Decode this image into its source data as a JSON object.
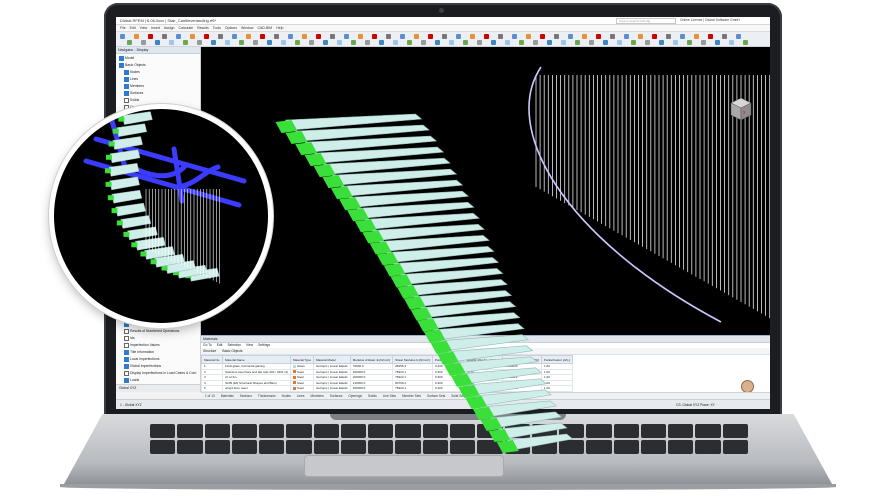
{
  "app": {
    "title": "Dlubal RFEM | 6.06.0xxx | Stair_Cantileverlanding.rf6*",
    "search_placeholder": "Type to search (Ctrl+Q)",
    "user": "Online License | Dlubal Software GmbH"
  },
  "menu": [
    "File",
    "Edit",
    "View",
    "Insert",
    "Assign",
    "Calculate",
    "Results",
    "Tools",
    "Options",
    "Window",
    "CAD-BIM",
    "Help"
  ],
  "navigator": {
    "title": "Navigator - Display",
    "items": [
      {
        "label": "Model",
        "checked": true
      },
      {
        "label": "Basic Objects",
        "checked": true
      },
      {
        "label": "Nodes",
        "checked": true
      },
      {
        "label": "Lines",
        "checked": true
      },
      {
        "label": "Members",
        "checked": true
      },
      {
        "label": "Surfaces",
        "checked": true
      },
      {
        "label": "Solids",
        "checked": false
      },
      {
        "label": "Openings",
        "checked": false
      },
      {
        "label": "Types for Nodes",
        "checked": false
      },
      {
        "label": "Types for Lines",
        "checked": false
      },
      {
        "label": "Types for Members",
        "checked": false
      },
      {
        "label": "Types for Surfaces",
        "checked": false
      },
      {
        "label": "Types for Solids",
        "checked": false
      },
      {
        "label": "Types for Special Objects",
        "checked": false
      },
      {
        "label": "Special Objects",
        "checked": false
      },
      {
        "label": "Guide Objects",
        "checked": false
      },
      {
        "label": "Types for Stability",
        "checked": false
      },
      {
        "label": "Types for Steel Design",
        "checked": false
      },
      {
        "label": "Types for Concrete Design",
        "checked": false
      },
      {
        "label": "Types for Timber Design",
        "checked": false
      },
      {
        "label": "Types for Aluminum Design",
        "checked": false
      },
      {
        "label": "Types for Modal Analysis",
        "checked": false
      },
      {
        "label": "Types for Spectral Analysis",
        "checked": false
      },
      {
        "label": "Types for Time History",
        "checked": false
      },
      {
        "label": "Types for Pushover Analysis",
        "checked": false
      },
      {
        "label": "Types for Harmonic Response",
        "checked": false
      },
      {
        "label": "Types for Building Model",
        "checked": false
      },
      {
        "label": "Types for Form-Finding",
        "checked": false
      },
      {
        "label": "Types for Cutting Patterns",
        "checked": false
      },
      {
        "label": "Types for Design Overview",
        "checked": false
      },
      {
        "label": "Types for Solids",
        "checked": false
      },
      {
        "label": "Types for Piles",
        "checked": false
      },
      {
        "label": "Types for Tables",
        "checked": false
      },
      {
        "label": "Types for Results",
        "checked": false
      },
      {
        "label": "Types for Members",
        "checked": false
      },
      {
        "label": "Types for Surfaces",
        "checked": false
      },
      {
        "label": "Types for Special",
        "checked": false
      },
      {
        "label": "Types for Lines",
        "checked": false
      },
      {
        "label": "Display 'Settings' m",
        "checked": true
      },
      {
        "label": "Results of Numbered Operations",
        "checked": false
      },
      {
        "label": "Ids",
        "checked": false
      },
      {
        "label": "Imperfection Values",
        "checked": false
      },
      {
        "label": "Title Information",
        "checked": true
      },
      {
        "label": "Local Imperfections",
        "checked": true
      },
      {
        "label": "Global Imperfections",
        "checked": true
      },
      {
        "label": "Display Imperfections in Load Cases & Com",
        "checked": false
      },
      {
        "label": "Loads",
        "checked": true
      },
      {
        "label": "Load Values",
        "checked": true
      },
      {
        "label": "Load Case Numbers",
        "checked": false
      },
      {
        "label": "Load Case Descriptions",
        "checked": false
      },
      {
        "label": "Max Information",
        "checked": false
      },
      {
        "label": "Self-weight",
        "checked": false
      },
      {
        "label": "Object Loads",
        "checked": true
      }
    ],
    "tabs": "Global XYZ"
  },
  "materials_panel": {
    "title": "Materials",
    "menu": [
      "Go To",
      "Edit",
      "Selection",
      "View",
      "Settings"
    ],
    "toolbar": [
      "Structure",
      "Basic Objects"
    ],
    "columns": [
      "Material No.",
      "Material Name",
      "Material Type",
      "Material Model",
      "Modulus of Elast. E [N/mm²]",
      "Shear Modulus G [N/mm²]",
      "Poisson's Ratio ν [-]",
      "Specific Weight γ [kN/m³]",
      "Coeff. of Th. Exp. α [1/°C]",
      "Partial Factor γM [-]"
    ],
    "rows": [
      {
        "no": "1",
        "name": "Float glass, horizontal glazing",
        "type": "Glass",
        "model": "Isotropic | Linear Elastic",
        "e": "70000.0",
        "g": "28455.3",
        "nu": "0.230",
        "gamma": "25.00",
        "alpha": "0.000009",
        "gm": "1.00",
        "color": "#b9d8e8"
      },
      {
        "no": "2",
        "name": "Stainless steel bars and flat rods 304 / 4301 (4)",
        "type": "Steel",
        "model": "Isotropic | Linear Elastic",
        "e": "200000.0",
        "g": "76923.1",
        "nu": "0.300",
        "gamma": "78.50",
        "alpha": "0.000016",
        "gm": "1.00",
        "color": "#e07a2e"
      },
      {
        "no": "3",
        "name": "ch al 3m",
        "type": "Steel",
        "model": "Isotropic | Linear Elastic",
        "e": "200000.0",
        "g": "76923.1",
        "nu": "0.300",
        "gamma": "78.50",
        "alpha": "0.000012",
        "gm": "1.00",
        "color": "#e07a2e"
      },
      {
        "no": "4",
        "name": "S235 (EN Structural Shapes and Bars)",
        "type": "Steel",
        "model": "Isotropic | Linear Elastic",
        "e": "210000.0",
        "g": "80769.2",
        "nu": "0.300",
        "gamma": "78.50",
        "alpha": "0.000012",
        "gm": "1.00",
        "color": "#e07a2e"
      },
      {
        "no": "5",
        "name": "wing4 titan, steel",
        "type": "Steel",
        "model": "Isotropic | Linear Elastic",
        "e": "200000.0",
        "g": "76923.1",
        "nu": "0.300",
        "gamma": "78.50",
        "alpha": "0.000012",
        "gm": "1.00",
        "color": "#e07a2e"
      },
      {
        "no": "6",
        "name": "S235 JR (EN Structural Shapes and Bars)",
        "type": "Steel",
        "model": "Isotropic | Linear Elastic",
        "e": "210000.0",
        "g": "80769.2",
        "nu": "0.300",
        "gamma": "78.50",
        "alpha": "0.000012",
        "gm": "1.00",
        "color": "#e07a2e"
      },
      {
        "no": "7",
        "name": "Stainless steel plate and rods 1.4301 (4)",
        "type": "Steel",
        "model": "Isotropic | Linear Elastic",
        "e": "200000.0",
        "g": "77137.1",
        "nu": "0.300",
        "gamma": "78.50",
        "alpha": "0.000016",
        "gm": "1.00",
        "color": "#e07a2e"
      }
    ]
  },
  "bottom_tabs": [
    "Materials",
    "Sections",
    "Thicknesses",
    "Nodes",
    "Lines",
    "Members",
    "Surfaces",
    "Openings",
    "Solids",
    "Line Sets",
    "Member Sets",
    "Surface Sets",
    "Solid Sets"
  ],
  "pager": "1 of 13",
  "status": {
    "left": "1 - Global XYZ",
    "right": "CS: Global XYZ   Plane: XY"
  },
  "colors": {
    "accent": "#2e7bd1",
    "stair_tread": "#cfeeea",
    "stair_support": "#3adf3a",
    "member_blue": "#3b3cff",
    "viewport_bg": "#000000"
  }
}
